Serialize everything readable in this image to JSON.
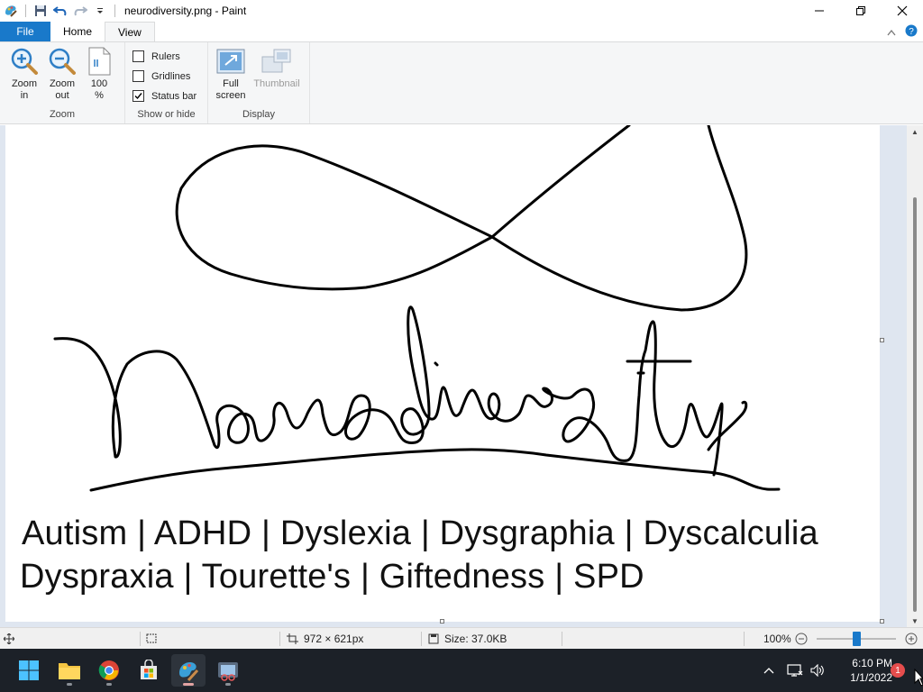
{
  "window": {
    "title": "neurodiversity.png - Paint"
  },
  "tabs": [
    {
      "label": "File"
    },
    {
      "label": "Home"
    },
    {
      "label": "View"
    }
  ],
  "ribbon": {
    "zoom_group": {
      "label": "Zoom",
      "zoom_in_line1": "Zoom",
      "zoom_in_line2": "in",
      "zoom_out_line1": "Zoom",
      "zoom_out_line2": "out",
      "hundred_line1": "100",
      "hundred_line2": "%"
    },
    "show_group": {
      "label": "Show or hide",
      "rulers": "Rulers",
      "rulers_checked": false,
      "gridlines": "Gridlines",
      "gridlines_checked": false,
      "statusbar": "Status bar",
      "statusbar_checked": true
    },
    "display_group": {
      "label": "Display",
      "fullscreen_line1": "Full",
      "fullscreen_line2": "screen",
      "thumbnail": "Thumbnail"
    }
  },
  "canvas": {
    "caption_line1": "Autism | ADHD | Dyslexia | Dysgraphia | Dyscalculia",
    "caption_line2": "Dyspraxia | Tourette's | Giftedness | SPD"
  },
  "statusbar": {
    "image_size": "972 × 621px",
    "file_size": "Size: 37.0KB",
    "zoom": "100%",
    "zoom_level_percent": 100
  },
  "taskbar": {
    "time": "6:10 PM",
    "date": "1/1/2022",
    "notification_count": "1"
  },
  "colors": {
    "file_tab": "#1979ca",
    "ribbon_bg": "#f5f6f7",
    "workspace_bg": "#dfe6f0",
    "taskbar_bg": "#1c2128"
  }
}
